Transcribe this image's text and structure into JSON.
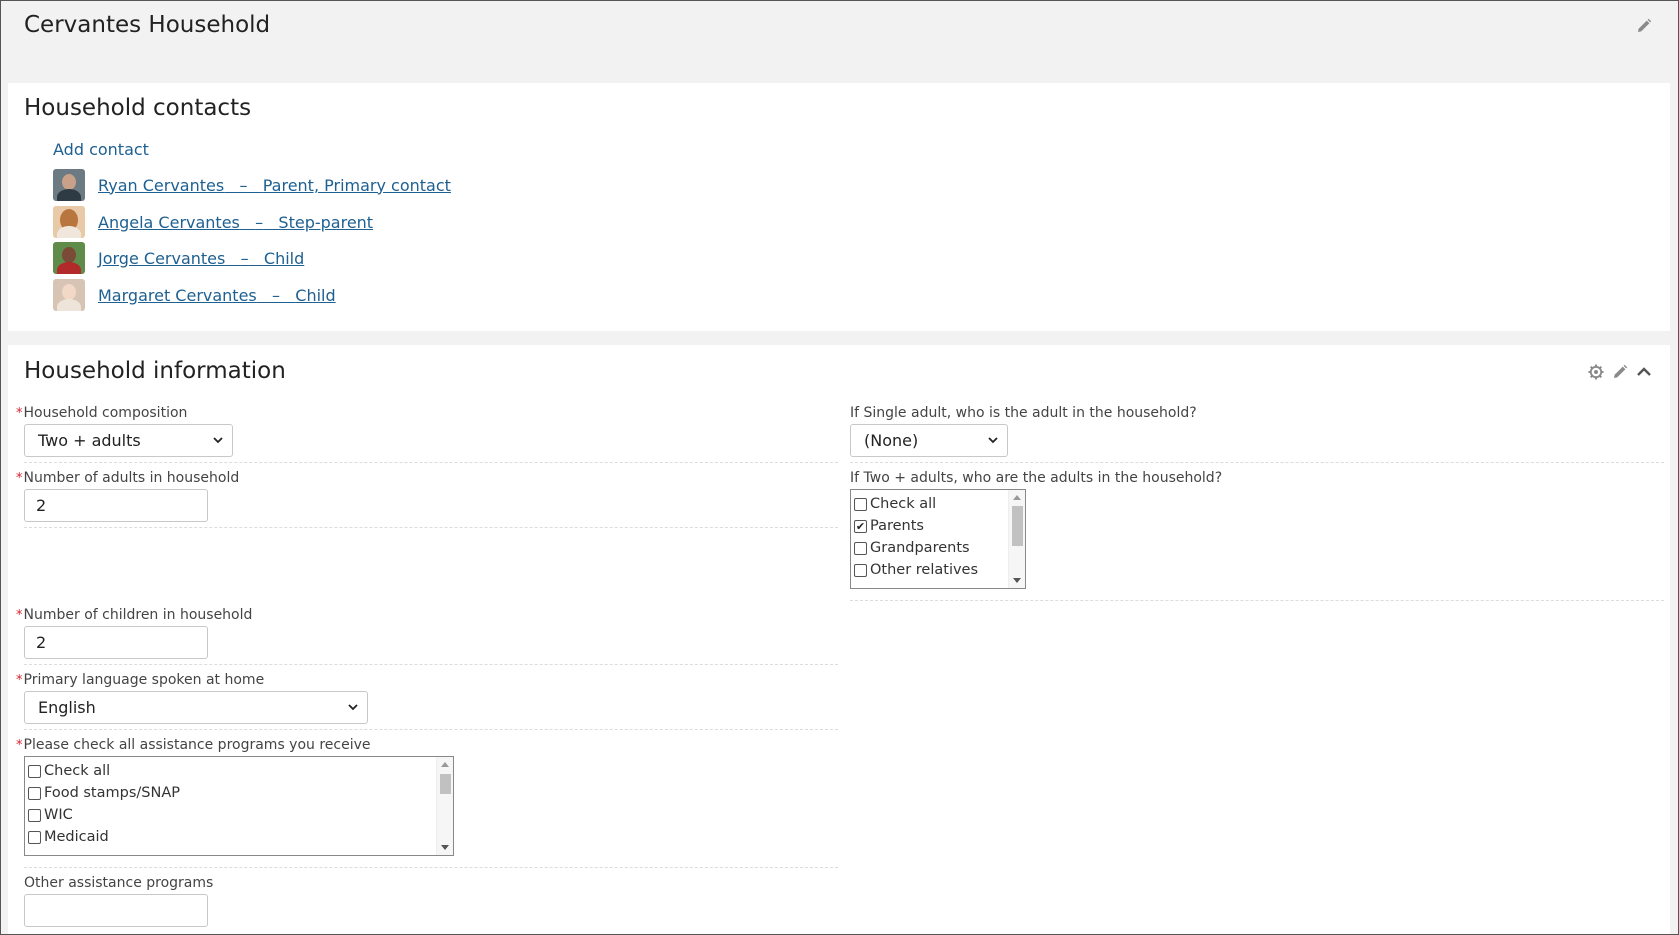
{
  "page": {
    "title": "Cervantes Household"
  },
  "contacts_panel": {
    "title": "Household contacts",
    "add_contact": "Add contact",
    "contacts": [
      {
        "name": "Ryan Cervantes",
        "role": "Parent, Primary contact"
      },
      {
        "name": "Angela Cervantes",
        "role": "Step-parent"
      },
      {
        "name": "Jorge Cervantes",
        "role": "Child"
      },
      {
        "name": "Margaret Cervantes",
        "role": "Child"
      }
    ],
    "separator": "–"
  },
  "info_panel": {
    "title": "Household information",
    "composition": {
      "label": "Household composition",
      "value": "Two + adults"
    },
    "adults_count": {
      "label": "Number of adults in household",
      "value": "2"
    },
    "children_count": {
      "label": "Number of children in household",
      "value": "2"
    },
    "language": {
      "label": "Primary language spoken at home",
      "value": "English"
    },
    "assistance": {
      "label": "Please check all assistance programs you receive",
      "options": [
        {
          "label": "Check all",
          "checked": false
        },
        {
          "label": "Food stamps/SNAP",
          "checked": false
        },
        {
          "label": "WIC",
          "checked": false
        },
        {
          "label": "Medicaid",
          "checked": false
        }
      ]
    },
    "other_assistance": {
      "label": "Other assistance programs",
      "value": ""
    },
    "single_adult": {
      "label": "If Single adult, who is the adult in the household?",
      "value": "(None)"
    },
    "two_adults": {
      "label": "If Two + adults, who are the adults in the household?",
      "options": [
        {
          "label": "Check all",
          "checked": false
        },
        {
          "label": "Parents",
          "checked": true
        },
        {
          "label": "Grandparents",
          "checked": false
        },
        {
          "label": "Other relatives",
          "checked": false
        }
      ]
    }
  },
  "colors": {
    "link": "#1e6091",
    "required": "#d9222a",
    "background": "#f2f2f2",
    "panel": "#ffffff"
  },
  "icons": {
    "edit": "pencil-icon",
    "settings": "gear-icon",
    "collapse": "chevron-up-icon"
  }
}
